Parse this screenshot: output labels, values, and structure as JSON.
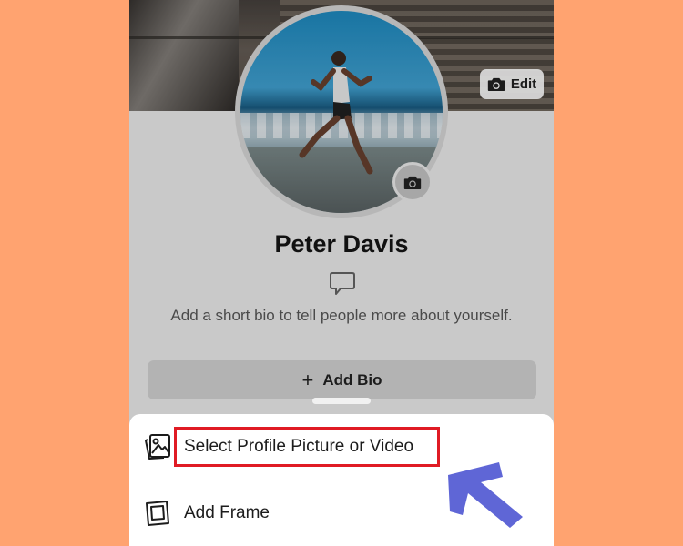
{
  "profile": {
    "name": "Peter Davis",
    "bio_prompt": "Add a short bio to tell people more about yourself.",
    "add_bio_label": "Add Bio",
    "add_bio_icon": "plus-icon"
  },
  "cover": {
    "edit_label": "Edit",
    "edit_icon": "camera-icon"
  },
  "sheet": {
    "items": [
      {
        "label": "Select Profile Picture or Video",
        "icon": "photo-icon",
        "highlighted": true
      },
      {
        "label": "Add Frame",
        "icon": "frame-icon",
        "highlighted": false
      }
    ]
  },
  "colors": {
    "background": "#ffa370",
    "highlight": "#e01b24",
    "arrow": "#5f66d6"
  }
}
